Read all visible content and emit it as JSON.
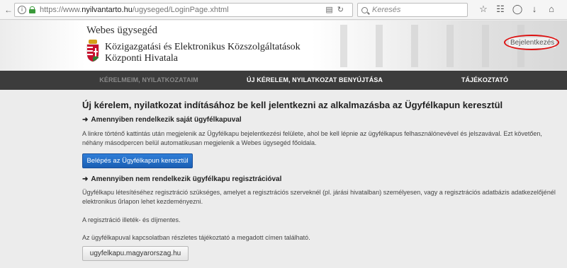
{
  "browser": {
    "url_prefix": "https://www.",
    "url_domain": "nyilvantarto.hu",
    "url_path": "/ugyseged/LoginPage.xhtml",
    "search_placeholder": "Keresés"
  },
  "header": {
    "site_title": "Webes ügysegéd",
    "org_line1": "Közigazgatási és Elektronikus Közszolgáltatások",
    "org_line2": "Központi Hivatala",
    "login_link": "Bejelentkezés"
  },
  "menu": {
    "items": [
      {
        "label": "KÉRELMEIM, NYILATKOZATAIM"
      },
      {
        "label": "ÚJ KÉRELEM, NYILATKOZAT BENYÚJTÁSA"
      },
      {
        "label": "TÁJÉKOZTATÓ"
      }
    ]
  },
  "main": {
    "title": "Új kérelem, nyilatkozat indításához be kell jelentkezni az alkalmazásba az Ügyfélkapun keresztül",
    "section1_heading": "Amennyiben rendelkezik saját ügyfélkapuval",
    "section1_text": "A linkre történő kattintás után megjelenik az Ügyfélkapu bejelentkezési felülete, ahol be kell lépnie az ügyfélkapus felhasználónevével és jelszavával. Ezt követően, néhány másodpercen belül automatikusan megjelenik a Webes ügysegéd főoldala.",
    "login_button": "Belépés az Ügyfélkapun keresztül",
    "section2_heading": "Amennyiben nem rendelkezik ügyfélkapu regisztrációval",
    "section2_text": "Ügyfélkapu létesítéséhez regisztráció szükséges, amelyet a regisztrációs szerveknél (pl. járási hivatalban) személyesen, vagy a regisztrációs adatbázis adatkezelőjénél elektronikus űrlapon lehet kezdeményezni.",
    "fee_text": "A regisztráció illeték- és díjmentes.",
    "info_text": "Az ügyfélkapuval kapcsolatban részletes tájékoztató a megadott címen található.",
    "link_button": "ugyfelkapu.magyarorszag.hu"
  },
  "colors": {
    "menu_bg": "#3c3c3c",
    "primary_button": "#1f6cc8",
    "highlight_ring": "#dd1111"
  }
}
